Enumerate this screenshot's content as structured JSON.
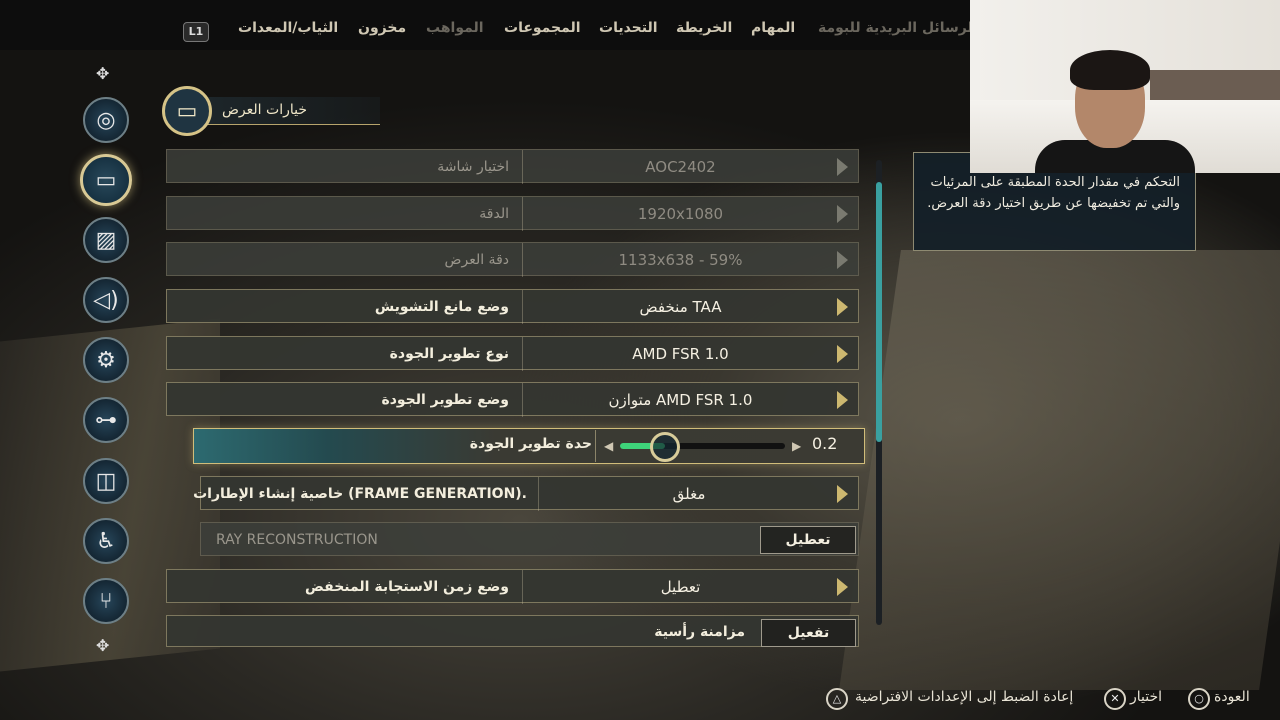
{
  "nav": {
    "l1": "L1",
    "items": [
      {
        "label": "الرسائل البريدية للبومة",
        "dim": true
      },
      {
        "label": "المهام",
        "dim": false
      },
      {
        "label": "الخريطة",
        "dim": false
      },
      {
        "label": "التحديات",
        "dim": false
      },
      {
        "label": "المجموعات",
        "dim": false
      },
      {
        "label": "المواهب",
        "dim": true
      },
      {
        "label": "مخزون",
        "dim": false
      },
      {
        "label": "الثياب/المعدات",
        "dim": false
      }
    ]
  },
  "sidebar": {
    "items": [
      {
        "name": "sidebar-item-gameplay",
        "icon": "disc-icon",
        "glyph": "⊘"
      },
      {
        "name": "sidebar-item-display",
        "icon": "monitor-icon",
        "glyph": "▭",
        "active": true
      },
      {
        "name": "sidebar-item-graphics",
        "icon": "image-icon",
        "glyph": "▨"
      },
      {
        "name": "sidebar-item-audio",
        "icon": "speaker-icon",
        "glyph": "🔊"
      },
      {
        "name": "sidebar-item-settings",
        "icon": "gear-icon",
        "glyph": "⚙"
      },
      {
        "name": "sidebar-item-controller",
        "icon": "gamepad-icon",
        "glyph": "🎮"
      },
      {
        "name": "sidebar-item-mouse",
        "icon": "mouse-icon",
        "glyph": "🖱"
      },
      {
        "name": "sidebar-item-accessibility",
        "icon": "accessibility-icon",
        "glyph": "♿"
      },
      {
        "name": "sidebar-item-network",
        "icon": "network-icon",
        "glyph": "⑂"
      }
    ]
  },
  "header": {
    "title": "خيارات العرض",
    "icon": "monitor-icon"
  },
  "settings": [
    {
      "label": "اختيار شاشة",
      "value": "AOC2402",
      "state": "dim"
    },
    {
      "label": "الدقة",
      "value": "1920x1080",
      "state": "dim"
    },
    {
      "label": "دقة العرض",
      "value": "1133x638 - 59%",
      "state": "dim"
    },
    {
      "label": "وضع مانع التشويش",
      "value": "منخفض TAA",
      "state": "bright"
    },
    {
      "label": "نوع تطوير الجودة",
      "value": "AMD FSR 1.0",
      "state": "bright"
    },
    {
      "label": "وضع تطوير الجودة",
      "value": "متوازن AMD FSR 1.0",
      "state": "bright"
    },
    {
      "label": "خاصية إنشاء الإطارات (FRAME GENERATION).",
      "value": "مغلق",
      "state": "bright"
    },
    {
      "label": "RAY RECONSTRUCTION",
      "value": "تعطيل",
      "state": "toggle-dim"
    },
    {
      "label": "وضع زمن الاستجابة المنخفض",
      "value": "تعطيل",
      "state": "bright"
    },
    {
      "label": "مزامنة رأسية",
      "value": "تفعيل",
      "state": "toggle-bright"
    }
  ],
  "slider": {
    "label": "حدة تطوير الجودة",
    "value": "0.2",
    "fraction": 0.2
  },
  "description": "التحكم في مقدار الحدة المطبقة على المرئيات والتي تم تخفيضها عن طريق اختيار دقة العرض.",
  "footer": {
    "back": "العودة",
    "select": "اختيار",
    "reset": "إعادة الضبط إلى الإعدادات الافتراضية"
  },
  "colors": {
    "accent": "#d5c387",
    "slider_fill": "#3ed37a",
    "scroll": "#3aa0a0"
  }
}
